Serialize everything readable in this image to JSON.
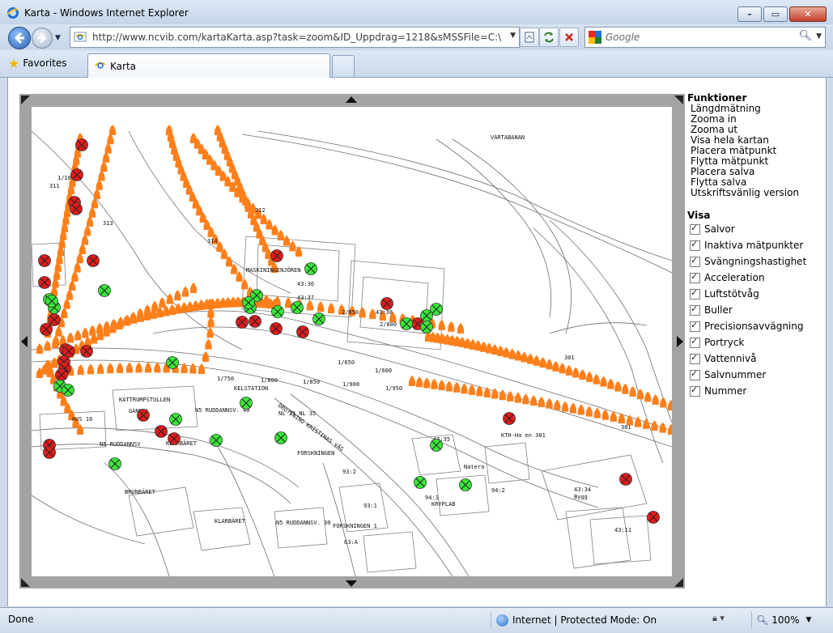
{
  "window": {
    "title": "Karta - Windows Internet Explorer"
  },
  "address_bar": {
    "url": "http://www.ncvib.com/kartaKarta.asp?task=zoom&ID_Uppdrag=1218&sMSSFile=C:\\GWMCach"
  },
  "search": {
    "placeholder": "Google"
  },
  "favorites": {
    "label": "Favorites"
  },
  "tabs": [
    {
      "label": "Karta"
    }
  ],
  "panel": {
    "funktioner_title": "Funktioner",
    "funktioner": [
      "Längdmätning",
      "Zooma in",
      "Zooma ut",
      "Visa hela kartan",
      "Placera mätpunkt",
      "Flytta mätpunkt",
      "Placera salva",
      "Flytta salva",
      "Utskriftsvänlig version"
    ],
    "visa_title": "Visa",
    "visa": [
      {
        "label": "Salvor",
        "checked": true
      },
      {
        "label": "Inaktiva mätpunkter",
        "checked": true
      },
      {
        "label": "Svängningshastighet",
        "checked": true
      },
      {
        "label": "Acceleration",
        "checked": true
      },
      {
        "label": "Luftstötvåg",
        "checked": true
      },
      {
        "label": "Buller",
        "checked": true
      },
      {
        "label": "Precisionsavvägning",
        "checked": true
      },
      {
        "label": "Portryck",
        "checked": true
      },
      {
        "label": "Vattennivå",
        "checked": true
      },
      {
        "label": "Salvnummer",
        "checked": true
      },
      {
        "label": "Nummer",
        "checked": true
      }
    ]
  },
  "map": {
    "labels": [
      "VÄRTABANAN",
      "1/10",
      "311",
      "313",
      "314",
      "312",
      "MASKININGENJÖREN",
      "43:36",
      "43:37",
      "2/850",
      "2/800",
      "43:38",
      "1/650",
      "1/600",
      "1/750",
      "1/800",
      "1/850",
      "1/900",
      "1/950",
      "301",
      "301",
      "KATTRUMPSTULLEN",
      "GANNAL",
      "HUS 16",
      "N5 RUDDANNSV. 40",
      "NL 33 NL 35",
      "FORSKNINGEN",
      "N5 RUDDANNSV",
      "KLARBÄRET",
      "BRUNBÄRET",
      "KLARBÄRET",
      "N5 RUDDANNSV. 30",
      "FORSKNINGEN 1",
      "93:2",
      "93:1",
      "94:1",
      "94:2",
      "KRYPLAB",
      "43:35",
      "Natera",
      "KTH-Ha en 301",
      "43:34",
      "Bygg",
      "43:11",
      "63:A",
      "DROTTNING KRISTINAS VÄG",
      "KELSTATION"
    ],
    "colors": {
      "salva": "#ff7f1a",
      "active_point": "#39e639",
      "inactive_point": "#e01b1b"
    }
  },
  "status": {
    "done": "Done",
    "zone": "Internet | Protected Mode: On",
    "zoom": "100%"
  }
}
